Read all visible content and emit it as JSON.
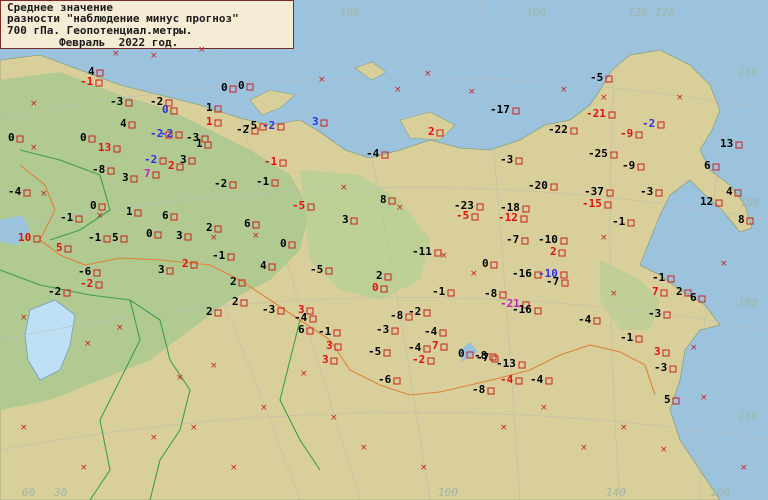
{
  "title": {
    "line1": "Среднее значение",
    "line2": "разности \"наблюдение минус прогноз\"",
    "line3": "700 гПа. Геопотенциал.метры.",
    "line4": "Февраль  2022 год."
  },
  "graticule_labels": [
    "160",
    "120",
    "140",
    "160",
    "180",
    "100",
    "140",
    "160",
    "140",
    "60",
    "30",
    "100",
    "120"
  ],
  "colors": {
    "ocean": "#9cc3dd",
    "land": "#d8cf9a",
    "lowland": "#a9c98f",
    "border_red": "#e0823a",
    "border_green": "#3fa043",
    "station": "#c82020",
    "value_black": "#000000",
    "value_red": "#e01010",
    "value_blue": "#3030e0",
    "value_purple": "#c020c0"
  },
  "values": [
    {
      "t": "4",
      "c": "k"
    },
    {
      "t": "-1",
      "c": "r"
    },
    {
      "t": "0",
      "c": "k"
    },
    {
      "t": "0",
      "c": "k"
    },
    {
      "t": "-3",
      "c": "k"
    },
    {
      "t": "-2",
      "c": "k"
    },
    {
      "t": "-2",
      "c": "b"
    },
    {
      "t": "0",
      "c": "b"
    },
    {
      "t": "1",
      "c": "k"
    },
    {
      "t": "1",
      "c": "r"
    },
    {
      "t": "4",
      "c": "k"
    },
    {
      "t": "0",
      "c": "k"
    },
    {
      "t": "-2",
      "c": "b"
    },
    {
      "t": "-2",
      "c": "k"
    },
    {
      "t": "-5",
      "c": "k"
    },
    {
      "t": "-2",
      "c": "b"
    },
    {
      "t": "3",
      "c": "b"
    },
    {
      "t": "2",
      "c": "r"
    },
    {
      "t": "-5",
      "c": "k"
    },
    {
      "t": "-17",
      "c": "k"
    },
    {
      "t": "-22",
      "c": "k"
    },
    {
      "t": "-21",
      "c": "r"
    },
    {
      "t": "-9",
      "c": "r"
    },
    {
      "t": "-2",
      "c": "b"
    },
    {
      "t": "13",
      "c": "k"
    },
    {
      "t": "0",
      "c": "k"
    },
    {
      "t": "13",
      "c": "r"
    },
    {
      "t": "-3",
      "c": "k"
    },
    {
      "t": "3",
      "c": "k"
    },
    {
      "t": "-2",
      "c": "b"
    },
    {
      "t": "7",
      "c": "p"
    },
    {
      "t": "2",
      "c": "r"
    },
    {
      "t": "-8",
      "c": "k"
    },
    {
      "t": "3",
      "c": "k"
    },
    {
      "t": "1",
      "c": "k"
    },
    {
      "t": "-2",
      "c": "k"
    },
    {
      "t": "-1",
      "c": "k"
    },
    {
      "t": "-1",
      "c": "r"
    },
    {
      "t": "-4",
      "c": "k"
    },
    {
      "t": "-3",
      "c": "k"
    },
    {
      "t": "-25",
      "c": "k"
    },
    {
      "t": "-9",
      "c": "k"
    },
    {
      "t": "6",
      "c": "k"
    },
    {
      "t": "-4",
      "c": "k"
    },
    {
      "t": "-1",
      "c": "k"
    },
    {
      "t": "0",
      "c": "k"
    },
    {
      "t": "-5",
      "c": "r"
    },
    {
      "t": "8",
      "c": "k"
    },
    {
      "t": "-23",
      "c": "k"
    },
    {
      "t": "-5",
      "c": "r"
    },
    {
      "t": "-20",
      "c": "k"
    },
    {
      "t": "-18",
      "c": "k"
    },
    {
      "t": "-12",
      "c": "r"
    },
    {
      "t": "-37",
      "c": "k"
    },
    {
      "t": "-15",
      "c": "r"
    },
    {
      "t": "-3",
      "c": "k"
    },
    {
      "t": "-1",
      "c": "k"
    },
    {
      "t": "4",
      "c": "k"
    },
    {
      "t": "12",
      "c": "k"
    },
    {
      "t": "8",
      "c": "k"
    },
    {
      "t": "10",
      "c": "r"
    },
    {
      "t": "5",
      "c": "r"
    },
    {
      "t": "-1",
      "c": "k"
    },
    {
      "t": "5",
      "c": "k"
    },
    {
      "t": "0",
      "c": "k"
    },
    {
      "t": "3",
      "c": "k"
    },
    {
      "t": "1",
      "c": "k"
    },
    {
      "t": "6",
      "c": "k"
    },
    {
      "t": "2",
      "c": "k"
    },
    {
      "t": "6",
      "c": "k"
    },
    {
      "t": "0",
      "c": "k"
    },
    {
      "t": "3",
      "c": "k"
    },
    {
      "t": "-6",
      "c": "k"
    },
    {
      "t": "-2",
      "c": "r"
    },
    {
      "t": "-2",
      "c": "k"
    },
    {
      "t": "3",
      "c": "k"
    },
    {
      "t": "2",
      "c": "r"
    },
    {
      "t": "-1",
      "c": "k"
    },
    {
      "t": "4",
      "c": "k"
    },
    {
      "t": "-5",
      "c": "k"
    },
    {
      "t": "-11",
      "c": "k"
    },
    {
      "t": "-7",
      "c": "k"
    },
    {
      "t": "-10",
      "c": "k"
    },
    {
      "t": "2",
      "c": "r"
    },
    {
      "t": "0",
      "c": "k"
    },
    {
      "t": "-16",
      "c": "k"
    },
    {
      "t": "-10",
      "c": "b"
    },
    {
      "t": "-7",
      "c": "k"
    },
    {
      "t": "2",
      "c": "k"
    },
    {
      "t": "0",
      "c": "r"
    },
    {
      "t": "-1",
      "c": "k"
    },
    {
      "t": "-8",
      "c": "k"
    },
    {
      "t": "-21",
      "c": "p"
    },
    {
      "t": "-16",
      "c": "k"
    },
    {
      "t": "-1",
      "c": "k"
    },
    {
      "t": "7",
      "c": "r"
    },
    {
      "t": "2",
      "c": "k"
    },
    {
      "t": "6",
      "c": "k"
    },
    {
      "t": "2",
      "c": "k"
    },
    {
      "t": "2",
      "c": "k"
    },
    {
      "t": "-3",
      "c": "k"
    },
    {
      "t": "2",
      "c": "k"
    },
    {
      "t": "-4",
      "c": "k"
    },
    {
      "t": "-2",
      "c": "k"
    },
    {
      "t": "6",
      "c": "k"
    },
    {
      "t": "3",
      "c": "r"
    },
    {
      "t": "-1",
      "c": "k"
    },
    {
      "t": "-3",
      "c": "k"
    },
    {
      "t": "-4",
      "c": "k"
    },
    {
      "t": "-5",
      "c": "k"
    },
    {
      "t": "7",
      "c": "r"
    },
    {
      "t": "0",
      "c": "k"
    },
    {
      "t": "-8",
      "c": "k"
    },
    {
      "t": "-4",
      "c": "k"
    },
    {
      "t": "-1",
      "c": "k"
    },
    {
      "t": "-3",
      "c": "k"
    },
    {
      "t": "3",
      "c": "r"
    },
    {
      "t": "3",
      "c": "r"
    },
    {
      "t": "3",
      "c": "r"
    },
    {
      "t": "-8",
      "c": "k"
    },
    {
      "t": "-4",
      "c": "k"
    },
    {
      "t": "-2",
      "c": "r"
    },
    {
      "t": "-7",
      "c": "k"
    },
    {
      "t": "-13",
      "c": "k"
    },
    {
      "t": "-4",
      "c": "r"
    },
    {
      "t": "-4",
      "c": "k"
    },
    {
      "t": "-6",
      "c": "k"
    },
    {
      "t": "-8",
      "c": "k"
    },
    {
      "t": "-3",
      "c": "k"
    },
    {
      "t": "5",
      "c": "k"
    }
  ]
}
